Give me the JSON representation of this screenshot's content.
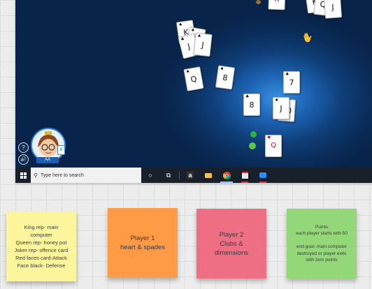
{
  "game": {
    "avatar": {
      "name": "AA",
      "badge": "6"
    },
    "side_buttons": {
      "help": "?",
      "sound": "🔊"
    },
    "cards": [
      {
        "rank": "K",
        "suit": "♠",
        "red": false
      },
      {
        "rank": "Q",
        "suit": "♠",
        "red": false
      },
      {
        "rank": "J",
        "suit": "♠",
        "red": false
      },
      {
        "rank": "K",
        "suit": "♠",
        "red": false
      },
      {
        "rank": "Q",
        "suit": "♠",
        "red": false
      },
      {
        "rank": "J",
        "suit": "♣",
        "red": false
      },
      {
        "rank": "J",
        "suit": "♠",
        "red": false
      },
      {
        "rank": "Q",
        "suit": "♠",
        "red": false
      },
      {
        "rank": "8",
        "suit": "♠",
        "red": false
      },
      {
        "rank": "7",
        "suit": "♣",
        "red": false
      },
      {
        "rank": "8",
        "suit": "♣",
        "red": false
      },
      {
        "rank": "10",
        "suit": "♠",
        "red": false
      },
      {
        "rank": "J",
        "suit": "♠",
        "red": false
      },
      {
        "rank": "Q",
        "suit": "♥",
        "red": true
      },
      {
        "rank": "K",
        "suit": "♥",
        "red": true
      }
    ]
  },
  "taskbar": {
    "start_icon": "windows-logo",
    "search_placeholder": "Type here to search",
    "icons": [
      "cortana-icon",
      "task-view-icon",
      "amazon-icon",
      "file-explorer-icon",
      "chrome-icon",
      "store-icon",
      "zoom-icon"
    ]
  },
  "notes": [
    {
      "text": "King rep- main\ncomputer\nQueen rep- honey pot\nJoker rep- offence card\nRed  faces card-Attack\nFace black- Defense",
      "color": "#fdf59b"
    },
    {
      "text": "Player 1\nheart & spades",
      "color": "#ff9a47"
    },
    {
      "text": "Player 2\nClubs &\ndimensions",
      "color": "#ee6e84"
    },
    {
      "text": "Points\neach player starts with 50\n\nend goal- main computer\ndestroyed or player exits\nwith zero points",
      "color": "#93d779"
    }
  ]
}
